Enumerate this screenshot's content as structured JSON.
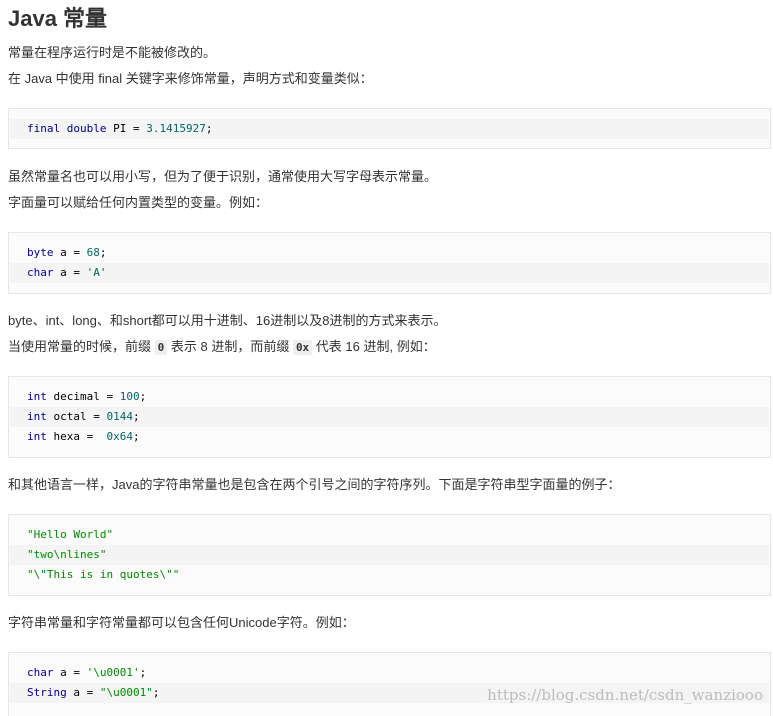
{
  "title": "Java 常量",
  "p1": "常量在程序运行时是不能被修改的。",
  "p2": "在 Java 中使用 final 关键字来修饰常量，声明方式和变量类似：",
  "code1": {
    "l1": {
      "kw1": "final",
      "kw2": "double",
      "name": " PI = ",
      "lit": "3.1415927",
      "end": ";"
    }
  },
  "p3": "虽然常量名也可以用小写，但为了便于识别，通常使用大写字母表示常量。",
  "p4": "字面量可以赋给任何内置类型的变量。例如：",
  "code2": {
    "l1": {
      "kw": "byte",
      "mid": " a = ",
      "lit": "68",
      "end": ";"
    },
    "l2": {
      "kw": "char",
      "mid": " a = ",
      "lit": "'A'"
    }
  },
  "p5": "byte、int、long、和short都可以用十进制、16进制以及8进制的方式来表示。",
  "p6": {
    "a": "当使用常量的时候，前缀 ",
    "code_a": "0",
    "b": " 表示 8 进制，而前缀 ",
    "code_b": "0x",
    "c": " 代表 16 进制, 例如："
  },
  "code3": {
    "l1": {
      "kw": "int",
      "mid": " decimal = ",
      "lit": "100",
      "end": ";"
    },
    "l2": {
      "kw": "int",
      "mid": " octal = ",
      "lit": "0144",
      "end": ";"
    },
    "l3": {
      "kw": "int",
      "mid": " hexa =  ",
      "lit": "0x64",
      "end": ";"
    }
  },
  "p7": "和其他语言一样，Java的字符串常量也是包含在两个引号之间的字符序列。下面是字符串型字面量的例子：",
  "code4": {
    "l1": "\"Hello World\"",
    "l2": "\"two\\nlines\"",
    "l3": "\"\\\"This is in quotes\\\"\""
  },
  "p8": "字符串常量和字符常量都可以包含任何Unicode字符。例如：",
  "code5": {
    "l1": {
      "kw": "char",
      "mid": " a = ",
      "str": "'\\u0001'",
      "end": ";"
    },
    "l2": {
      "kw": "String",
      "mid": " a = ",
      "str": "\"\\u0001\"",
      "end": ";"
    }
  },
  "watermark": "https://blog.csdn.net/csdn_wanziooo",
  "colors": {
    "keyword": "#000088",
    "literal": "#006666",
    "string": "#008800",
    "code_bg": "#fbfbfb",
    "code_alt_bg": "#f4f4f4"
  }
}
